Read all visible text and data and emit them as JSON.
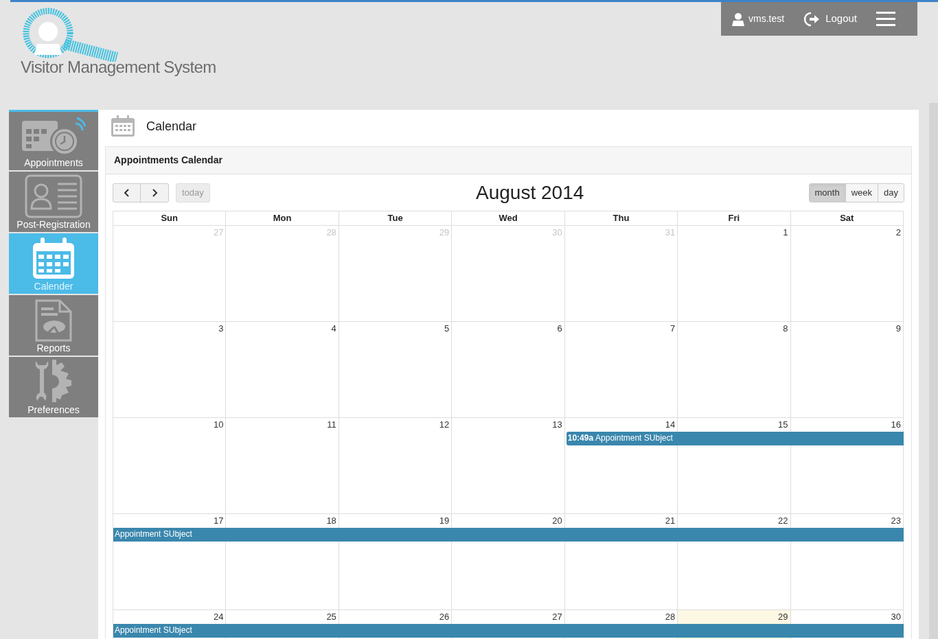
{
  "header": {
    "app_title": "Visitor Management System",
    "user": "vms.test",
    "logout": "Logout"
  },
  "sidebar": {
    "items": [
      {
        "label": "Appointments",
        "kind": "appointments",
        "selected": false
      },
      {
        "label": "Post-Registration",
        "kind": "registration",
        "selected": false
      },
      {
        "label": "Calender",
        "kind": "calendar",
        "selected": true
      },
      {
        "label": "Reports",
        "kind": "reports",
        "selected": false
      },
      {
        "label": "Preferences",
        "kind": "preferences",
        "selected": false
      }
    ]
  },
  "page_title": "Calendar",
  "panel_title": "Appointments Calendar",
  "toolbar": {
    "today": "today",
    "title": "August 2014",
    "views": [
      {
        "label": "month",
        "selected": true
      },
      {
        "label": "week",
        "selected": false
      },
      {
        "label": "day",
        "selected": false
      }
    ]
  },
  "day_names": [
    "Sun",
    "Mon",
    "Tue",
    "Wed",
    "Thu",
    "Fri",
    "Sat"
  ],
  "weeks": [
    {
      "days": [
        {
          "label": "27",
          "other_month": true,
          "today": false
        },
        {
          "label": "28",
          "other_month": true,
          "today": false
        },
        {
          "label": "29",
          "other_month": true,
          "today": false
        },
        {
          "label": "30",
          "other_month": true,
          "today": false
        },
        {
          "label": "31",
          "other_month": true,
          "today": false
        },
        {
          "label": "1",
          "other_month": false,
          "today": false
        },
        {
          "label": "2",
          "other_month": false,
          "today": false
        }
      ]
    },
    {
      "days": [
        {
          "label": "3",
          "other_month": false,
          "today": false
        },
        {
          "label": "4",
          "other_month": false,
          "today": false
        },
        {
          "label": "5",
          "other_month": false,
          "today": false
        },
        {
          "label": "6",
          "other_month": false,
          "today": false
        },
        {
          "label": "7",
          "other_month": false,
          "today": false
        },
        {
          "label": "8",
          "other_month": false,
          "today": false
        },
        {
          "label": "9",
          "other_month": false,
          "today": false
        }
      ]
    },
    {
      "days": [
        {
          "label": "10",
          "other_month": false,
          "today": false
        },
        {
          "label": "11",
          "other_month": false,
          "today": false
        },
        {
          "label": "12",
          "other_month": false,
          "today": false
        },
        {
          "label": "13",
          "other_month": false,
          "today": false
        },
        {
          "label": "14",
          "other_month": false,
          "today": false,
          "event": {
            "time": "10:49a",
            "title": "Appointment SUbject"
          }
        },
        {
          "label": "15",
          "other_month": false,
          "today": false
        },
        {
          "label": "16",
          "other_month": false,
          "today": false
        }
      ]
    },
    {
      "days": [
        {
          "label": "17",
          "other_month": false,
          "today": false,
          "event": {
            "title": "Appointment SUbject"
          }
        },
        {
          "label": "18",
          "other_month": false,
          "today": false
        },
        {
          "label": "19",
          "other_month": false,
          "today": false
        },
        {
          "label": "20",
          "other_month": false,
          "today": false
        },
        {
          "label": "21",
          "other_month": false,
          "today": false
        },
        {
          "label": "22",
          "other_month": false,
          "today": false
        },
        {
          "label": "23",
          "other_month": false,
          "today": false
        }
      ]
    },
    {
      "days": [
        {
          "label": "24",
          "other_month": false,
          "today": false,
          "event": {
            "title": "Appointment SUbject"
          }
        },
        {
          "label": "25",
          "other_month": false,
          "today": false
        },
        {
          "label": "26",
          "other_month": false,
          "today": false
        },
        {
          "label": "27",
          "other_month": false,
          "today": false
        },
        {
          "label": "28",
          "other_month": false,
          "today": false
        },
        {
          "label": "29",
          "other_month": false,
          "today": true
        },
        {
          "label": "30",
          "other_month": false,
          "today": false
        }
      ]
    }
  ]
}
